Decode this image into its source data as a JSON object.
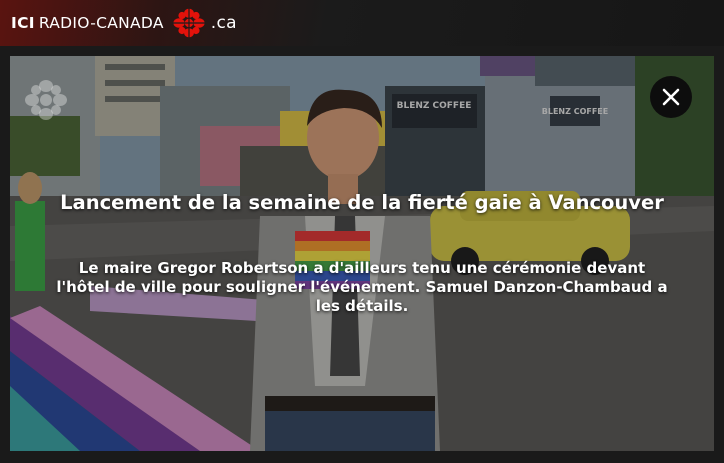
{
  "header": {
    "brand_ici": "ICI",
    "brand_name": "RADIO-CANADA",
    "brand_domain": ".ca",
    "logo_icon": "cbc-gem-icon",
    "accent_color": "#e3120b"
  },
  "video": {
    "watermark_icon": "cbc-gem-watermark-icon",
    "close_icon": "close-icon",
    "storefront_sign_1": "BLENZ COFFEE",
    "storefront_sign_2": "BLENZ COFFEE",
    "title": "Lancement de la semaine de la fierté gaie à Vancouver",
    "description": "Le maire Gregor Robertson a d'ailleurs tenu une cérémonie devant l'hôtel de ville pour souligner l'événement. Samuel Danzon-Chambaud a les détails."
  }
}
